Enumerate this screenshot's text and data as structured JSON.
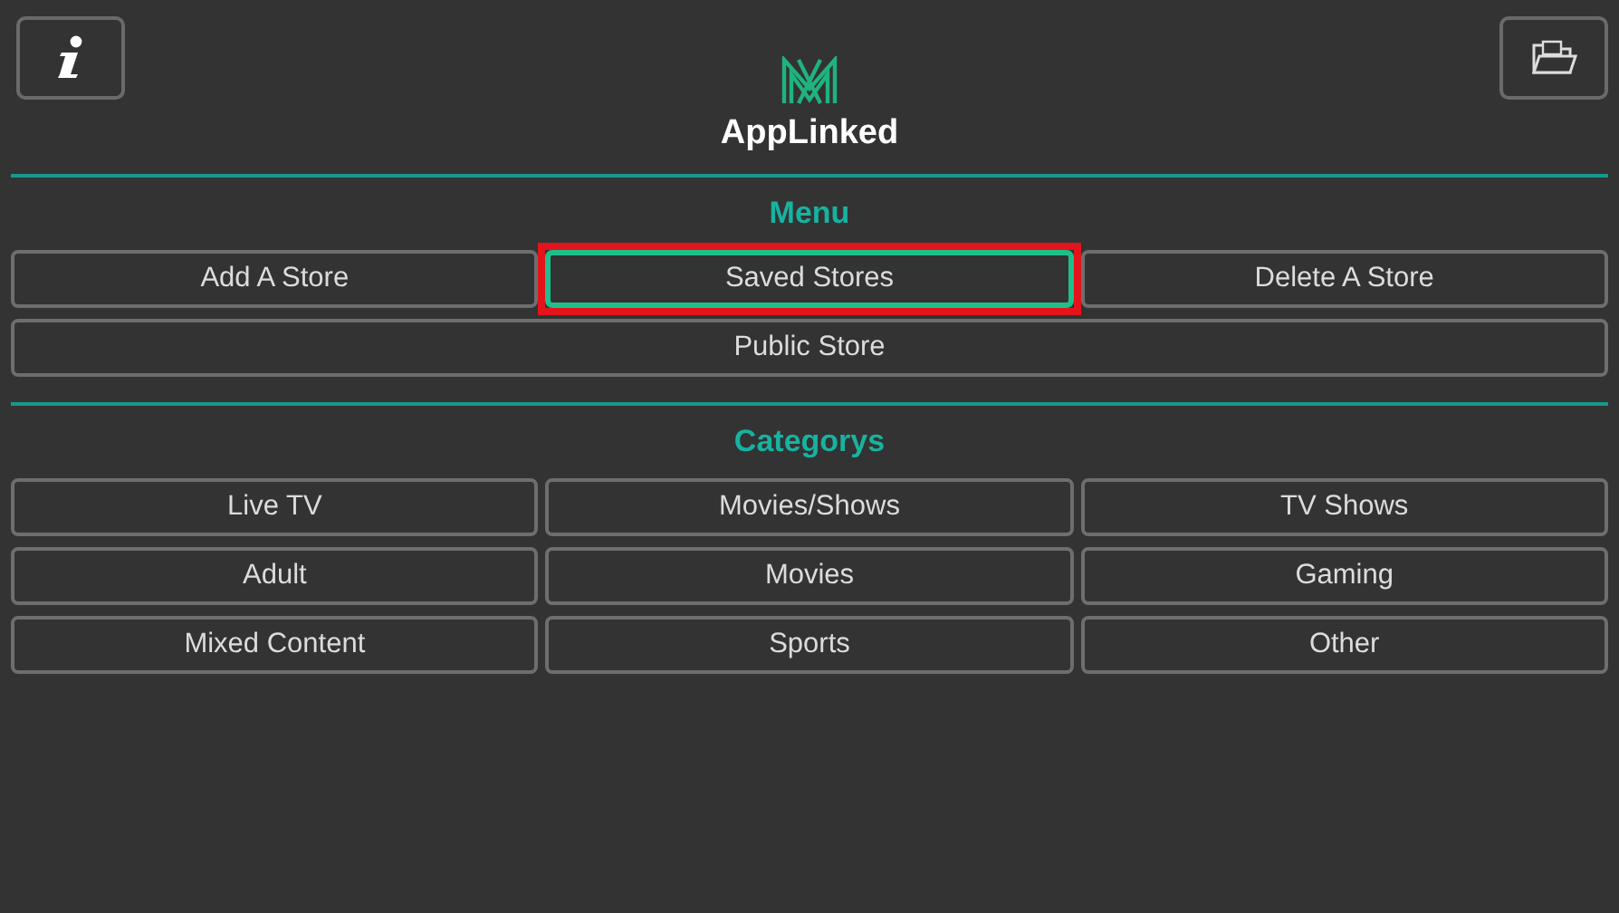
{
  "app": {
    "title": "AppLinked"
  },
  "menu": {
    "title": "Menu",
    "items": [
      {
        "label": "Add A Store",
        "kind": "cell",
        "selected": false
      },
      {
        "label": "Saved Stores",
        "kind": "cell",
        "selected": true
      },
      {
        "label": "Delete A Store",
        "kind": "cell",
        "selected": false
      },
      {
        "label": "Public Store",
        "kind": "wide",
        "selected": false
      }
    ]
  },
  "categories": {
    "title": "Categorys",
    "items": [
      {
        "label": "Live TV",
        "selected": false
      },
      {
        "label": "Movies/Shows",
        "selected": false
      },
      {
        "label": "TV Shows",
        "selected": false
      },
      {
        "label": "Adult",
        "selected": false
      },
      {
        "label": "Movies",
        "selected": false
      },
      {
        "label": "Gaming",
        "selected": false
      },
      {
        "label": "Mixed Content",
        "selected": false
      },
      {
        "label": "Sports",
        "selected": false
      },
      {
        "label": "Other",
        "selected": false
      }
    ]
  }
}
